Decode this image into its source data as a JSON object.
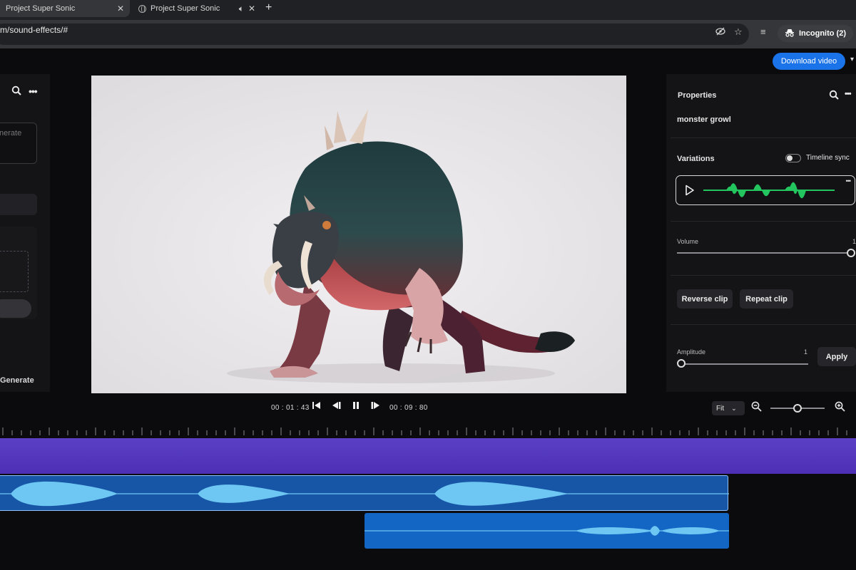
{
  "browser": {
    "tabs": [
      {
        "title": "Project Super Sonic"
      },
      {
        "title": "Project Super Sonic"
      }
    ],
    "url": "m/sound-effects/#",
    "incognito_label": "Incognito (2)"
  },
  "app": {
    "download_label": "Download video",
    "left_panel": {
      "prompt_placeholder": "nerate",
      "generate_label": "Generate"
    },
    "properties": {
      "title": "Properties",
      "clip_name": "monster growl",
      "variations_label": "Variations",
      "timeline_sync_label": "Timeline sync",
      "timeline_sync_on": false,
      "volume_label": "Volume",
      "volume_max": "1",
      "volume_value": 1.0,
      "reverse_label": "Reverse clip",
      "repeat_label": "Repeat clip",
      "amplitude_label": "Amplitude",
      "amplitude_value": "1",
      "apply_label": "Apply"
    },
    "transport": {
      "current_time": "00 : 01 : 43",
      "total_time": "00 : 09 : 80",
      "zoom_fit": "Fit"
    }
  },
  "colors": {
    "accent": "#1a73e8",
    "waveform_green": "#22c55e",
    "video_track": "#5b3fc4",
    "audio_track": "#1756a6",
    "waveform_blue": "#6ec6f2"
  }
}
